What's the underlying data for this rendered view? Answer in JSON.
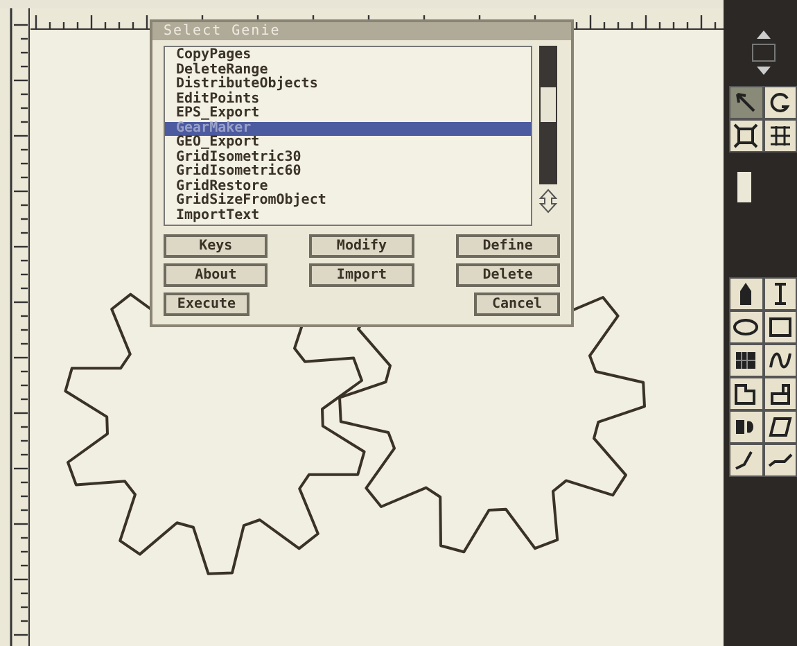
{
  "dialog": {
    "title": "Select Genie",
    "items": [
      {
        "label": "CopyPages",
        "selected": false
      },
      {
        "label": "DeleteRange",
        "selected": false
      },
      {
        "label": "DistributeObjects",
        "selected": false
      },
      {
        "label": "EditPoints",
        "selected": false
      },
      {
        "label": "EPS_Export",
        "selected": false
      },
      {
        "label": "GearMaker",
        "selected": true
      },
      {
        "label": "GEO_Export",
        "selected": false
      },
      {
        "label": "GridIsometric30",
        "selected": false
      },
      {
        "label": "GridIsometric60",
        "selected": false
      },
      {
        "label": "GridRestore",
        "selected": false
      },
      {
        "label": "GridSizeFromObject",
        "selected": false
      },
      {
        "label": "ImportText",
        "selected": false
      }
    ],
    "buttons": [
      [
        "Keys",
        "Modify",
        "Define"
      ],
      [
        "About",
        "Import",
        "Delete"
      ],
      [
        "Execute",
        "Cancel"
      ]
    ]
  },
  "toolbox": {
    "tools_top": [
      {
        "kind": "pointer",
        "selected": true
      },
      {
        "kind": "rotate",
        "selected": false
      },
      {
        "kind": "resize",
        "selected": false
      },
      {
        "kind": "group",
        "selected": false
      }
    ],
    "tools": [
      {
        "kind": "pen",
        "selected": false
      },
      {
        "kind": "text",
        "selected": false
      },
      {
        "kind": "ellipse",
        "selected": false
      },
      {
        "kind": "rect",
        "selected": false
      },
      {
        "kind": "grid",
        "selected": false
      },
      {
        "kind": "curve",
        "selected": false
      },
      {
        "kind": "frame",
        "selected": false
      },
      {
        "kind": "link",
        "selected": false
      },
      {
        "kind": "shape",
        "selected": false
      },
      {
        "kind": "slant",
        "selected": false
      },
      {
        "kind": "line",
        "selected": false
      },
      {
        "kind": "polyline",
        "selected": false
      }
    ]
  }
}
